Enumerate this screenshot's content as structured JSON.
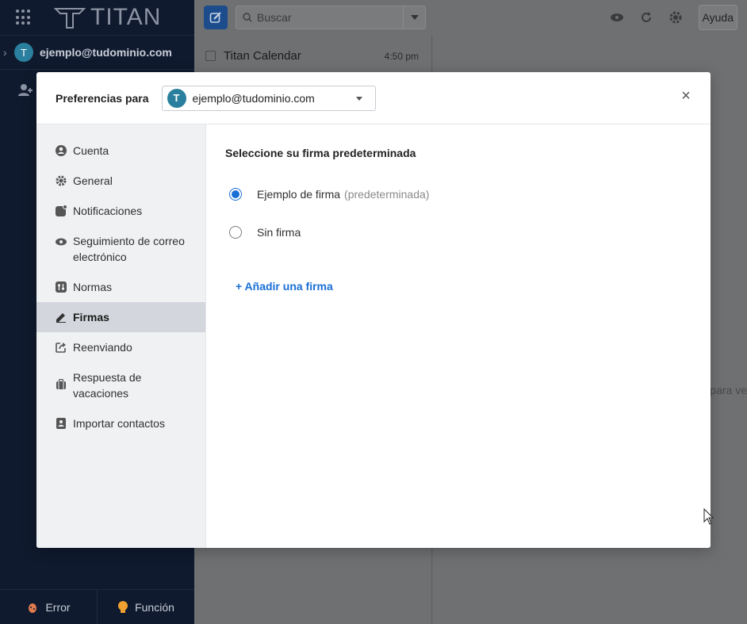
{
  "app": {
    "logo_text": "TITAN",
    "account_initial": "T",
    "account_email": "ejemplo@tudominio.com",
    "bottom": {
      "error_label": "Error",
      "feature_label": "Función"
    }
  },
  "topbar": {
    "search_placeholder": "Buscar",
    "help_label": "Ayuda"
  },
  "mail_list": {
    "items": [
      {
        "sender": "Titan Calendar",
        "time": "4:50 pm"
      }
    ]
  },
  "reading_pane": {
    "hint_fragment": "para ve"
  },
  "modal": {
    "header_label": "Preferencias para",
    "account_initial": "T",
    "account_email": "ejemplo@tudominio.com",
    "close_glyph": "×",
    "nav": [
      {
        "label": "Cuenta",
        "icon": "user-circle-icon"
      },
      {
        "label": "General",
        "icon": "gear-icon"
      },
      {
        "label": "Notificaciones",
        "icon": "notification-icon"
      },
      {
        "label": "Seguimiento de correo electrónico",
        "icon": "eye-icon"
      },
      {
        "label": "Normas",
        "icon": "rules-icon"
      },
      {
        "label": "Firmas",
        "icon": "pen-icon",
        "active": true
      },
      {
        "label": "Reenviando",
        "icon": "forward-icon"
      },
      {
        "label": "Respuesta de vacaciones",
        "icon": "suitcase-icon"
      },
      {
        "label": "Importar contactos",
        "icon": "contacts-icon"
      }
    ],
    "content": {
      "title": "Seleccione su firma predeterminada",
      "options": [
        {
          "label": "Ejemplo de firma",
          "tag": "(predeterminada)",
          "checked": true
        },
        {
          "label": "Sin firma",
          "tag": "",
          "checked": false
        }
      ],
      "add_link": "+ Añadir una firma"
    }
  },
  "colors": {
    "sidebar_bg": "#0f1a2e",
    "accent": "#1a6fd6",
    "avatar": "#2a7f9e",
    "nav_active": "#d3d6dc"
  }
}
